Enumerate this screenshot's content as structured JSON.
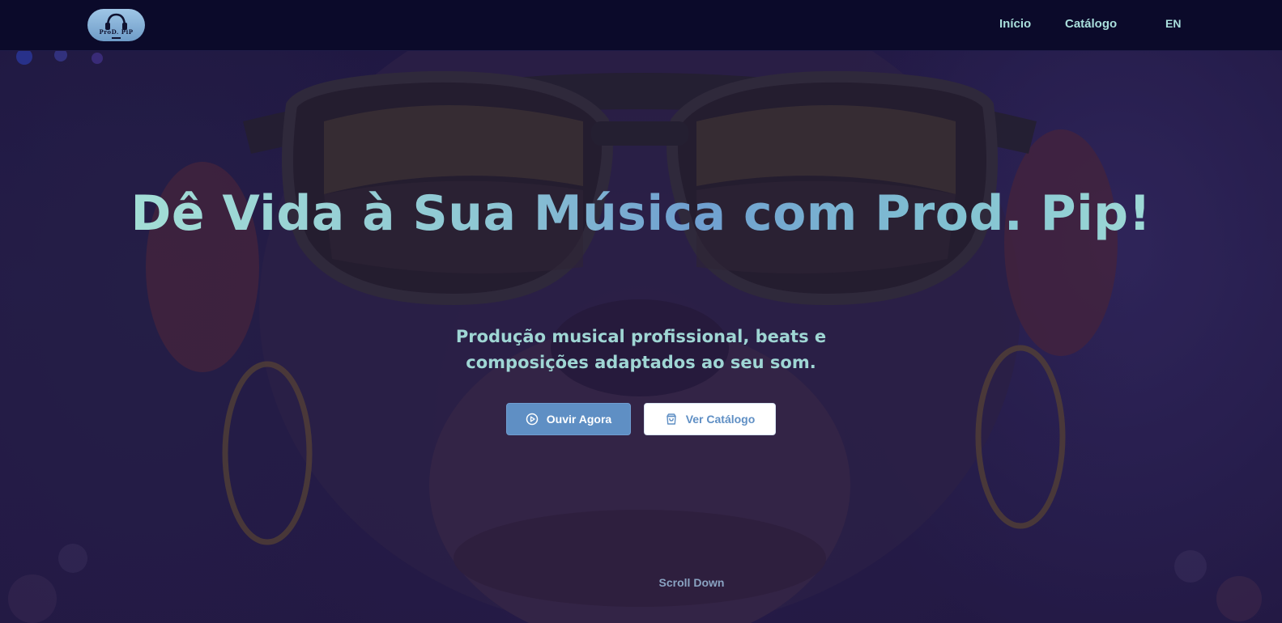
{
  "brand": {
    "logo_text": "ProD. PiP"
  },
  "nav": {
    "home_label": "Início",
    "catalog_label": "Catálogo",
    "language_label": "EN"
  },
  "hero": {
    "title": "Dê Vida à Sua Música com Prod. Pip!",
    "subtitle": "Produção musical profissional, beats e composições adaptados ao seu som.",
    "listen_button_label": "Ouvir Agora",
    "listen_button_icon": "play-circle-icon",
    "catalog_button_label": "Ver Catálogo",
    "catalog_button_icon": "shopping-bag-icon",
    "scroll_label": "Scroll Down",
    "background_image": "monkey-with-sunglasses"
  },
  "colors": {
    "nav_background": "#0b0a2a",
    "nav_text": "#a9dfdc",
    "title_gradient_start": "#a4dfd6",
    "title_gradient_mid": "#6f9fd0",
    "subtitle": "#9fd6d4",
    "primary_button": "#5f8fc4",
    "secondary_button_background": "#ffffff",
    "scroll_text": "#8aa3c2"
  }
}
